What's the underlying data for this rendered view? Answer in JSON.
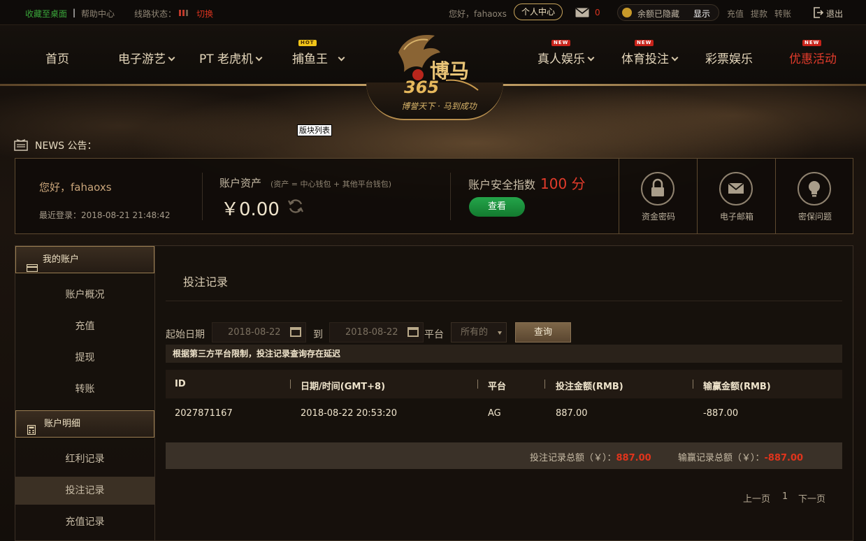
{
  "topbar": {
    "bookmark": "收藏至桌面",
    "divider": "|",
    "help": "帮助中心",
    "line_status_label": "线路状态：",
    "switch": "切换",
    "greeting": "您好，fahaoxs",
    "personal_center": "个人中心",
    "mail_count": "0",
    "balance_hidden": "余额已隐藏",
    "show": "显示",
    "deposit": "充值",
    "withdraw": "提款",
    "transfer": "转账",
    "logout": "退出"
  },
  "nav": {
    "home": "首页",
    "egames": "电子游艺",
    "pt_slots": "PT 老虎机",
    "fishing": "捕鱼王",
    "fishing_tag": "HOT",
    "live": "真人娱乐",
    "live_tag": "NEW",
    "sports": "体育投注",
    "sports_tag": "NEW",
    "lottery": "彩票娱乐",
    "promo": "优惠活动",
    "promo_tag": "NEW"
  },
  "logo": {
    "brand": "博马365",
    "slogan": "博誉天下 · 马到成功"
  },
  "tooltip": "版块列表",
  "news": {
    "label": "NEWS 公告："
  },
  "account": {
    "greeting": "您好，fahaoxs",
    "last_login": "最近登录：2018-08-21 21:48:42",
    "assets_label": "账户资产",
    "assets_note": "(资产 = 中心钱包 + 其他平台钱包)",
    "assets_value": "￥0.00",
    "security_label": "账户安全指数",
    "security_score": "100 分",
    "view_button": "查看",
    "fund_password": "资金密码",
    "email": "电子邮箱",
    "security_question": "密保问题"
  },
  "sidebar": {
    "my_account": "我的账户",
    "items1": [
      "账户概况",
      "充值",
      "提现",
      "转账"
    ],
    "account_detail": "账户明细",
    "items2": [
      "红利记录",
      "投注记录",
      "充值记录"
    ],
    "active": "投注记录"
  },
  "main": {
    "title": "投注记录",
    "start_date_label": "起始日期",
    "start_date": "2018-08-22",
    "to_label": "到",
    "end_date": "2018-08-22",
    "platform_label": "平台",
    "platform_value": "所有的",
    "query_button": "查询",
    "notice": "根据第三方平台限制，投注记录查询存在延迟",
    "table": {
      "headers": [
        "ID",
        "日期/时间(GMT+8)",
        "平台",
        "投注金额(RMB)",
        "输赢金额(RMB)"
      ],
      "rows": [
        [
          "2027871167",
          "2018-08-22 20:53:20",
          "AG",
          "887.00",
          "-887.00"
        ]
      ]
    },
    "summary": {
      "bet_total_label": "投注记录总额（￥）：",
      "bet_total": "887.00",
      "win_total_label": "输赢记录总额（￥）：",
      "win_total": "-887.00"
    },
    "pager": {
      "prev": "上一页",
      "page": "1",
      "next": "下一页"
    }
  },
  "colors": {
    "accent_gold": "#c9a55c",
    "promo_red": "#e23b2b",
    "status_green": "#3aa53a",
    "negative_red": "#e0341c",
    "view_button_green": "#1f9642"
  }
}
